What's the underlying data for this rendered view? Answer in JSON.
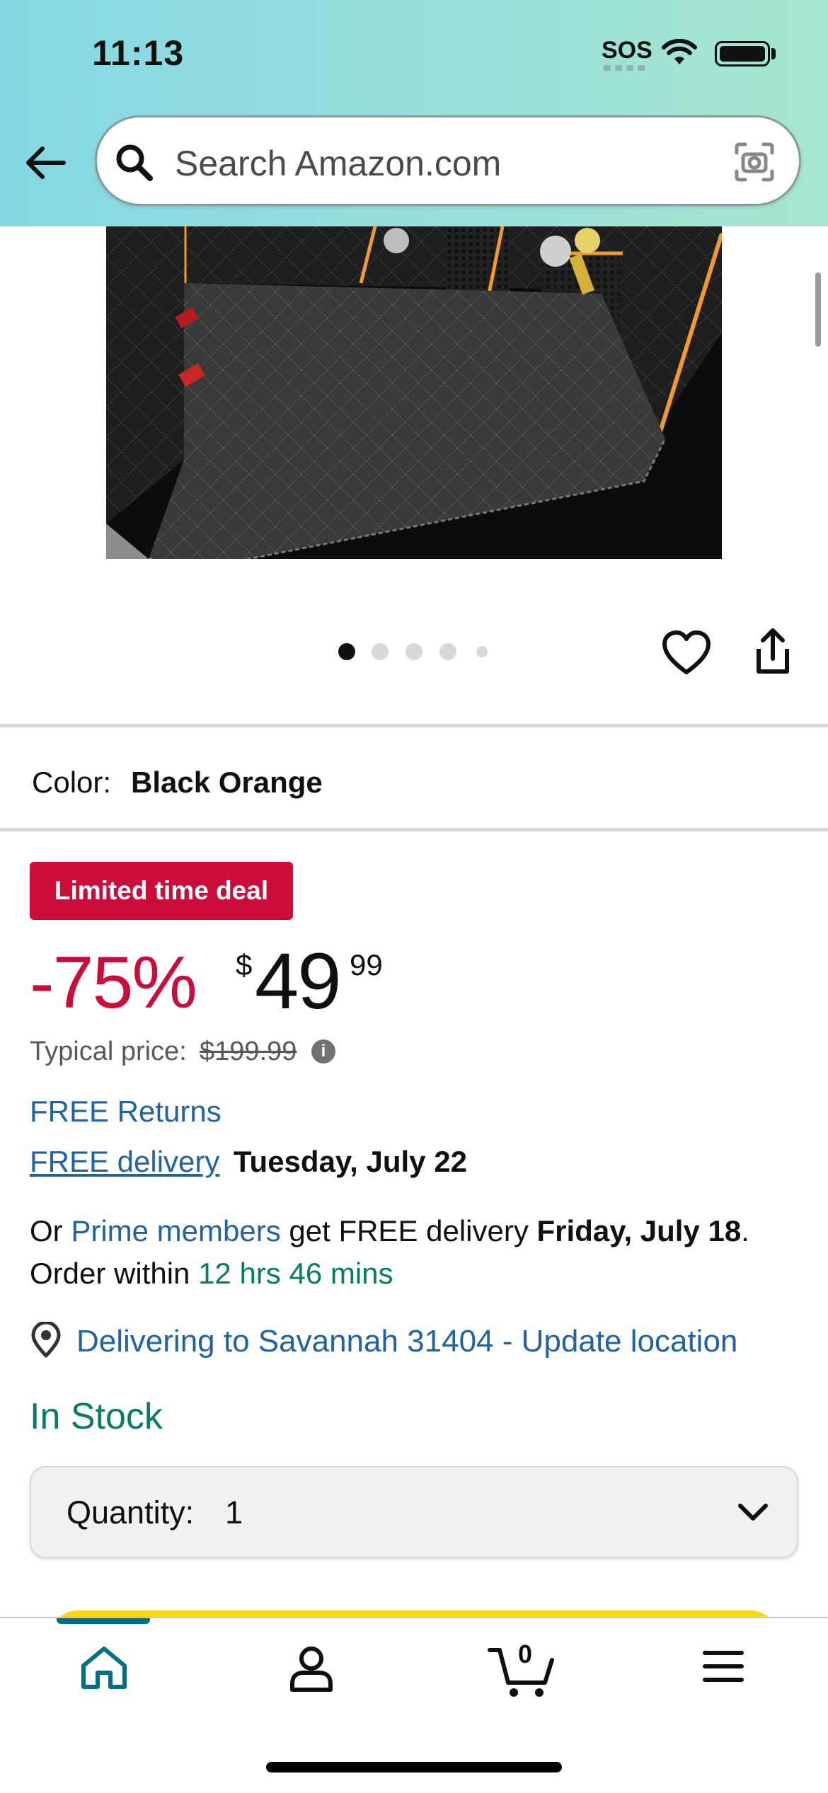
{
  "status_bar": {
    "time": "11:13",
    "sos": "SOS"
  },
  "search": {
    "placeholder": "Search Amazon.com"
  },
  "carousel": {
    "total_dots": 5,
    "active_index": 0
  },
  "color": {
    "label": "Color:",
    "value": "Black Orange"
  },
  "deal": {
    "badge": "Limited time deal",
    "discount": "-75%",
    "currency_symbol": "$",
    "price_whole": "49",
    "price_fraction": "99",
    "typical_label": "Typical price:",
    "typical_value": "$199.99",
    "info_glyph": "i"
  },
  "shipping": {
    "free_returns": "FREE Returns",
    "free_delivery_link": "FREE delivery",
    "delivery_date": "Tuesday, July 22",
    "prime_prefix": "Or ",
    "prime_link": "Prime members",
    "prime_middle": " get FREE delivery ",
    "prime_date": "Friday, July 18",
    "prime_suffix": ".",
    "order_prefix": "Order within ",
    "order_countdown": "12 hrs 46 mins",
    "location": "Delivering to Savannah 31404 - Update location"
  },
  "stock": {
    "status": "In Stock"
  },
  "quantity": {
    "label": "Quantity:",
    "value": "1"
  },
  "bottom_nav": {
    "cart_count": "0"
  },
  "colors": {
    "header_gradient": [
      "#84d8e3",
      "#a6e6cf"
    ],
    "deal_red": "#cc0c39",
    "link_blue": "#2162a1",
    "stock_green": "#067d62",
    "nav_teal": "#007185",
    "cart_button_yellow": "#ffd814"
  },
  "icons": [
    "back-arrow-icon",
    "search-icon",
    "camera-icon",
    "heart-icon",
    "share-icon",
    "location-pin-icon",
    "chevron-down-icon",
    "home-icon",
    "account-icon",
    "cart-icon",
    "menu-icon"
  ]
}
